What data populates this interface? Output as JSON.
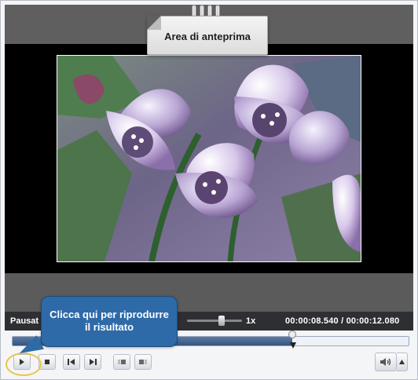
{
  "preview": {
    "note_title": "Area di anteprima"
  },
  "status": {
    "state": "Pausat",
    "speed": "1x",
    "time": "00:00:08.540 / 00:00:12.080"
  },
  "timeline": {
    "progress": 0.706
  },
  "tooltip": {
    "line1": "Clicca qui per riprodurre",
    "line2": "il risultato"
  },
  "controls": {
    "buttons": [
      "play",
      "stop",
      "previous-frame",
      "next-frame",
      "split-left",
      "split-right",
      "volume",
      "volume-menu"
    ]
  },
  "colors": {
    "accent": "#2f6aa8",
    "highlight": "#e9c54c",
    "timeline_fill": "#33537e"
  }
}
